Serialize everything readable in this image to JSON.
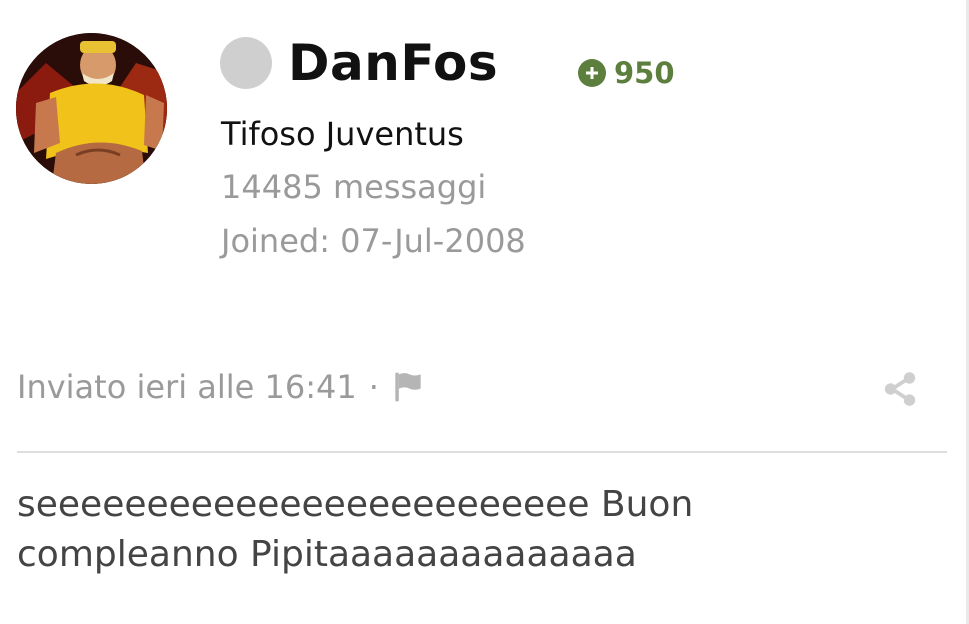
{
  "post": {
    "author": {
      "username": "DanFos",
      "reputation": "950",
      "rank": "Tifoso Juventus",
      "posts": "14485 messaggi",
      "joined": "Joined: 07-Jul-2008",
      "avatar_icon": "avatar-photo",
      "status_icon": "offline-status-dot",
      "reputation_icon": "plus-circle-icon"
    },
    "meta": {
      "posted": "Inviato ieri alle 16:41",
      "separator": "·",
      "report_icon": "flag-icon",
      "share_icon": "share-icon"
    },
    "body": {
      "line1": "seeeeeeeeeeeeeeeeeeeeeeeee Buon",
      "line2": "compleanno Pipitaaaaaaaaaaaaaa"
    }
  },
  "colors": {
    "reputation": "#5d7f3d",
    "muted_text": "#9a9a9a",
    "status_offline": "#cfcfcf"
  }
}
